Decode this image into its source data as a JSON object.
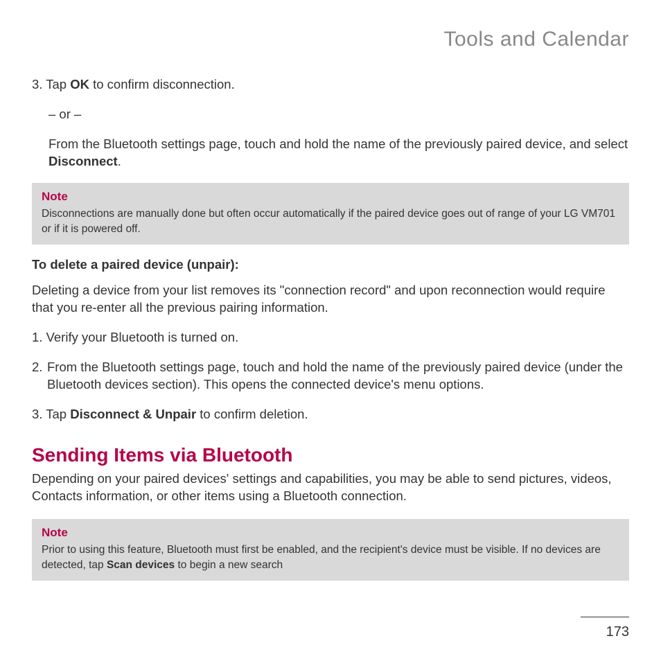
{
  "header": {
    "section_title": "Tools and Calendar"
  },
  "steps_a": {
    "s3_pre": "3. Tap ",
    "s3_bold": "OK",
    "s3_post": " to confirm disconnection.",
    "or": "– or –",
    "alt_pre": "From the Bluetooth settings page, touch and hold the name of the previously paired device, and select ",
    "alt_bold": "Disconnect",
    "alt_post": "."
  },
  "note1": {
    "label": "Note",
    "body": "Disconnections are manually done but often occur automatically if the paired device goes out of range of your LG VM701 or if it is powered off."
  },
  "delete": {
    "subhead": "To delete a paired device (unpair):",
    "intro": "Deleting a device from your list removes its \"connection record\" and upon reconnection would require that you re-enter all the previous pairing information.",
    "s1": "1. Verify your Bluetooth is turned on.",
    "s2": "2. From the Bluetooth settings page, touch and hold the name of the previously paired device (under the Bluetooth devices section). This opens the connected device's menu options.",
    "s3_pre": "3. Tap ",
    "s3_bold": "Disconnect & Unpair",
    "s3_post": " to confirm deletion."
  },
  "sending": {
    "heading": "Sending Items via Bluetooth",
    "intro": "Depending on your paired devices' settings and capabilities, you may be able to send pictures, videos, Contacts information, or other items using a Bluetooth connection."
  },
  "note2": {
    "label": "Note",
    "body_pre": "Prior to using this feature, Bluetooth must first be enabled, and the recipient's device must be visible. If no devices are detected, tap ",
    "body_bold": "Scan devices",
    "body_post": " to begin a new search"
  },
  "footer": {
    "page": "173"
  }
}
